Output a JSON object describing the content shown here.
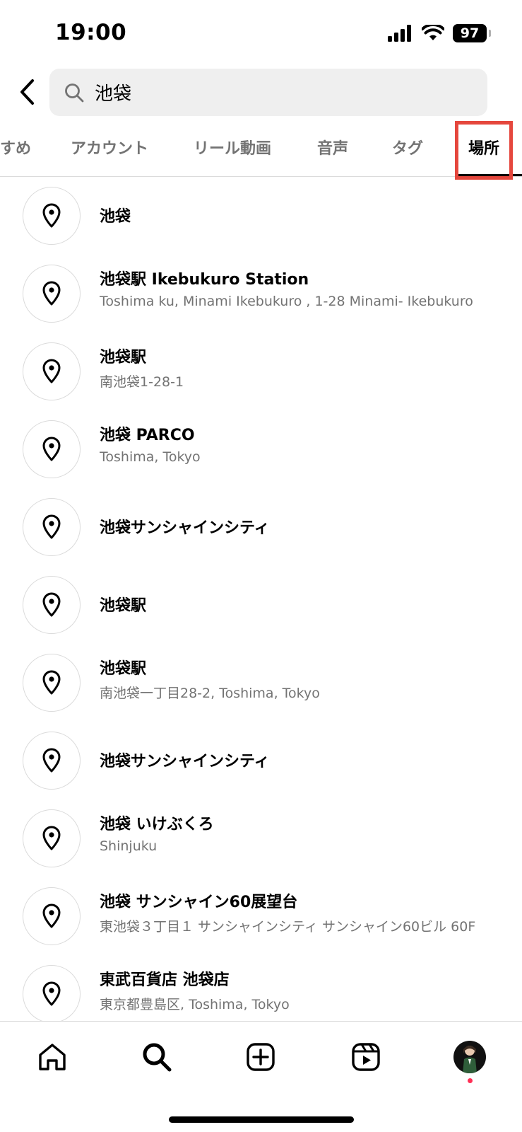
{
  "status_bar": {
    "time": "19:00",
    "battery": "97"
  },
  "search": {
    "query": "池袋"
  },
  "tabs": [
    {
      "label": "すめ",
      "active": false
    },
    {
      "label": "アカウント",
      "active": false
    },
    {
      "label": "リール動画",
      "active": false
    },
    {
      "label": "音声",
      "active": false
    },
    {
      "label": "タグ",
      "active": false
    },
    {
      "label": "場所",
      "active": true
    }
  ],
  "places": [
    {
      "name": "池袋",
      "sub": ""
    },
    {
      "name": "池袋駅 Ikebukuro Station",
      "sub": "Toshima ku, Minami Ikebukuro , 1-28 Minami- Ikebukuro"
    },
    {
      "name": "池袋駅",
      "sub": "南池袋1-28-1"
    },
    {
      "name": "池袋 PARCO",
      "sub": "Toshima, Tokyo"
    },
    {
      "name": "池袋サンシャインシティ",
      "sub": ""
    },
    {
      "name": "池袋駅",
      "sub": ""
    },
    {
      "name": "池袋駅",
      "sub": "南池袋一丁目28-2, Toshima, Tokyo"
    },
    {
      "name": "池袋サンシャインシティ",
      "sub": ""
    },
    {
      "name": "池袋 いけぶくろ",
      "sub": "Shinjuku"
    },
    {
      "name": "池袋 サンシャイン60展望台",
      "sub": "東池袋３丁目１ サンシャインシティ サンシャイン60ビル 60F"
    },
    {
      "name": "東武百貨店 池袋店",
      "sub": "東京都豊島区, Toshima, Tokyo"
    }
  ],
  "icons": {
    "back": "chevron-left-icon",
    "search": "search-icon",
    "place": "location-pin-icon",
    "nav": [
      "home-icon",
      "search-icon",
      "create-icon",
      "reels-icon",
      "profile-avatar"
    ]
  },
  "colors": {
    "highlight": "#e5473d",
    "notification": "#ff2f55",
    "muted_text": "#737373"
  }
}
